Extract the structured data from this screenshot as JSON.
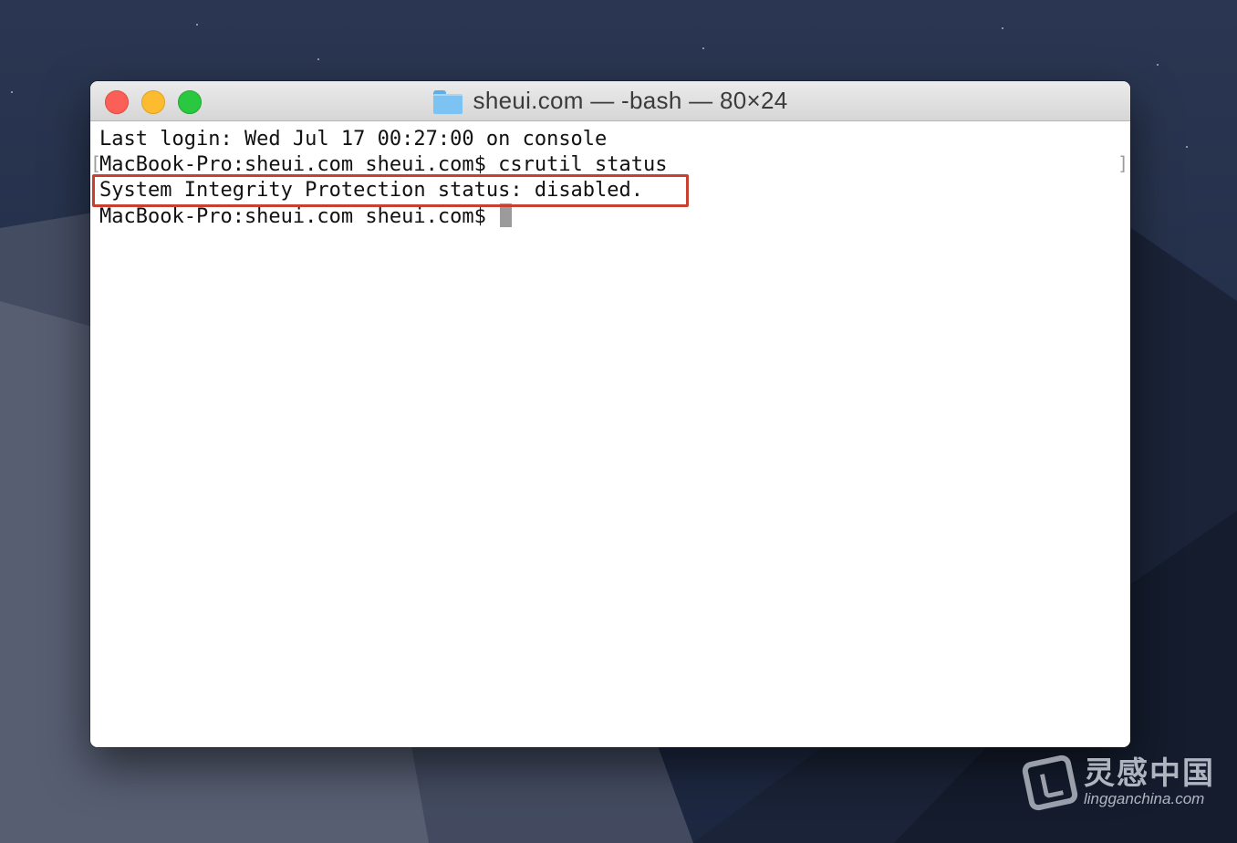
{
  "window": {
    "title": "sheui.com — -bash — 80×24"
  },
  "terminal": {
    "lines": [
      "Last login: Wed Jul 17 00:27:00 on console",
      "MacBook-Pro:sheui.com sheui.com$ csrutil status",
      "System Integrity Protection status: disabled.",
      "MacBook-Pro:sheui.com sheui.com$ "
    ]
  },
  "watermark": {
    "cn": "灵感中国",
    "en": "lingganchina.com"
  },
  "colors": {
    "highlight": "#c8402f",
    "close": "#fc5f57",
    "minimize": "#fdbc2f",
    "maximize": "#2ac841"
  },
  "icons": [
    "folder-icon",
    "close-button",
    "minimize-button",
    "maximize-button"
  ]
}
